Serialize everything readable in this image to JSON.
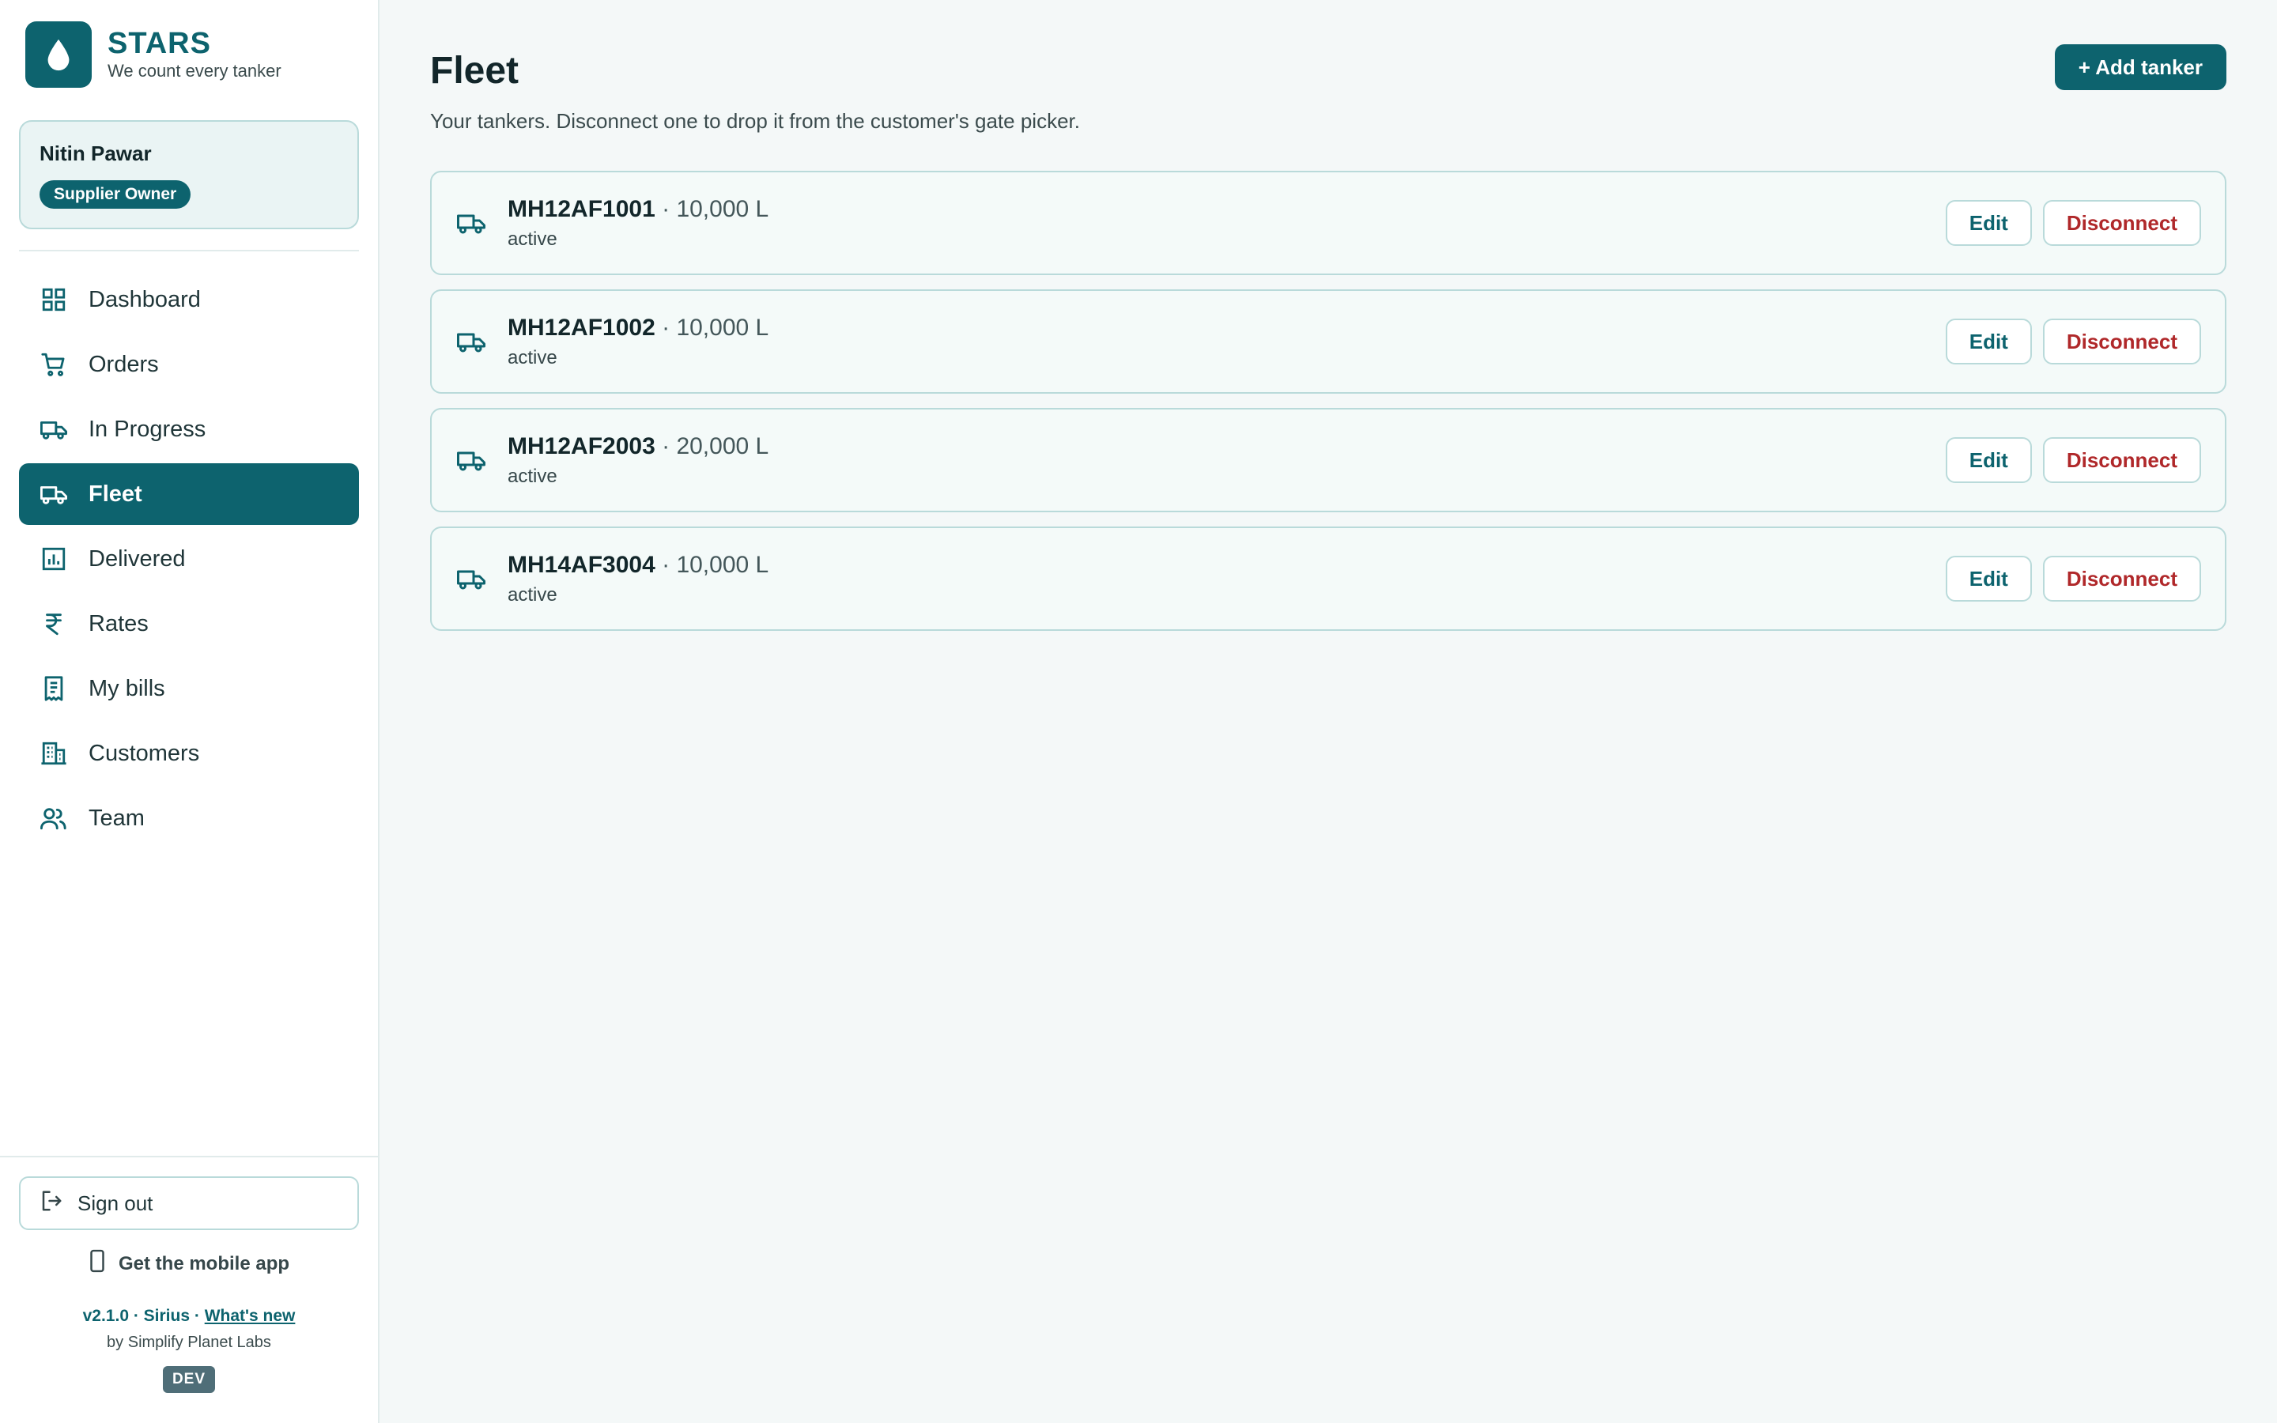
{
  "brand": {
    "name": "STARS",
    "tagline": "We count every tanker"
  },
  "user": {
    "name": "Nitin Pawar",
    "role": "Supplier Owner"
  },
  "sidebar": {
    "items": [
      {
        "label": "Dashboard",
        "icon": "grid-icon",
        "active": false
      },
      {
        "label": "Orders",
        "icon": "cart-icon",
        "active": false
      },
      {
        "label": "In Progress",
        "icon": "truck-icon",
        "active": false
      },
      {
        "label": "Fleet",
        "icon": "truck-icon",
        "active": true
      },
      {
        "label": "Delivered",
        "icon": "bar-chart-icon",
        "active": false
      },
      {
        "label": "Rates",
        "icon": "rupee-icon",
        "active": false
      },
      {
        "label": "My bills",
        "icon": "receipt-icon",
        "active": false
      },
      {
        "label": "Customers",
        "icon": "building-icon",
        "active": false
      },
      {
        "label": "Team",
        "icon": "users-icon",
        "active": false
      }
    ],
    "sign_out": "Sign out",
    "mobile_app": "Get the mobile app",
    "version": "v2.1.0",
    "version_sep1": " · ",
    "codename": "Sirius",
    "version_sep2": " · ",
    "whats_new": "What's new",
    "byline": "by Simplify Planet Labs",
    "env_badge": "DEV"
  },
  "page": {
    "title": "Fleet",
    "subtitle": "Your tankers. Disconnect one to drop it from the customer's gate picker.",
    "add_button": "+ Add tanker",
    "edit_label": "Edit",
    "disconnect_label": "Disconnect",
    "separator": " · "
  },
  "tankers": [
    {
      "plate": "MH12AF1001",
      "capacity": "10,000 L",
      "status": "active"
    },
    {
      "plate": "MH12AF1002",
      "capacity": "10,000 L",
      "status": "active"
    },
    {
      "plate": "MH12AF2003",
      "capacity": "20,000 L",
      "status": "active"
    },
    {
      "plate": "MH14AF3004",
      "capacity": "10,000 L",
      "status": "active"
    }
  ],
  "colors": {
    "primary": "#0d636e",
    "danger": "#b0282a",
    "background": "#f4f8f8",
    "border": "#b9dada"
  }
}
